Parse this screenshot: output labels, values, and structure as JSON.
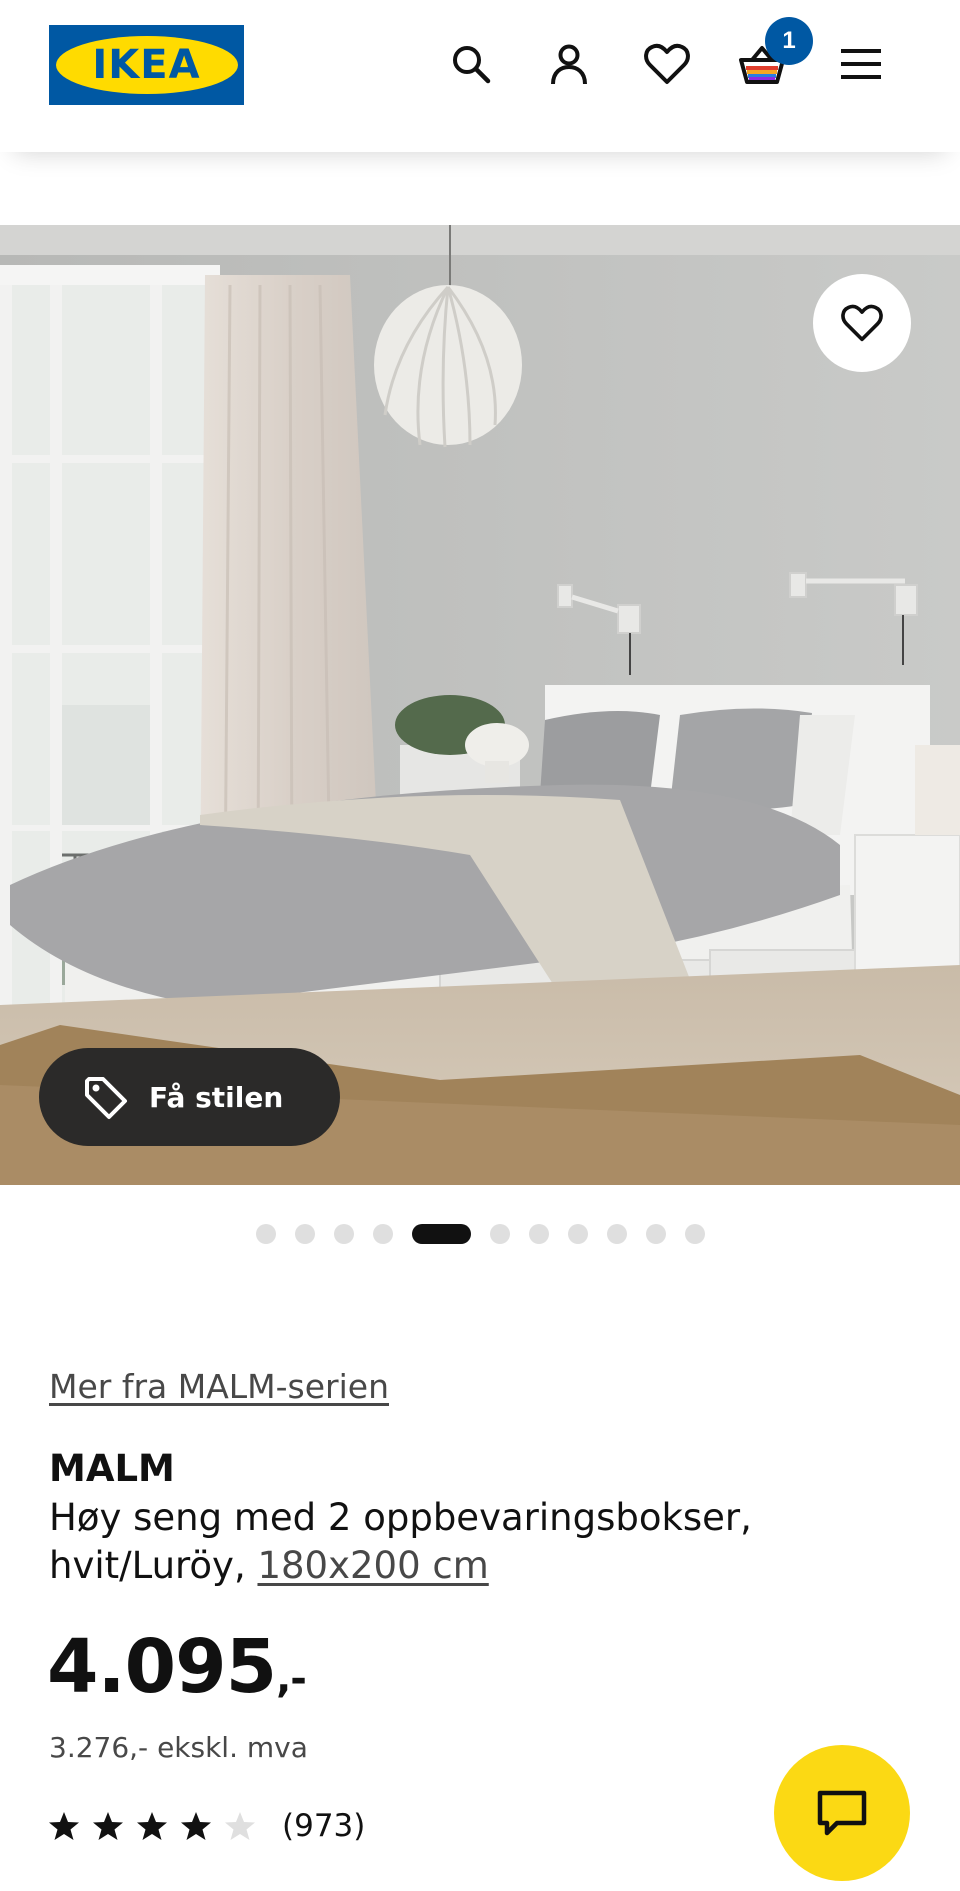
{
  "header": {
    "logo_text": "IKEA",
    "icons": [
      "search-icon",
      "account-icon",
      "heart-icon",
      "cart-icon",
      "menu-icon"
    ],
    "cart_count": "1"
  },
  "hero": {
    "style_button_label": "Få stilen",
    "image_count": 11,
    "active_image_index": 4
  },
  "product": {
    "series_link": "Mer fra MALM-serien",
    "name": "MALM",
    "description": "Høy seng med 2 oppbevaringsbokser, hvit/Luröy, ",
    "size_link": "180x200 cm",
    "price_main": "4.095",
    "price_suffix": ",-",
    "price_ex_vat": "3.276,- ekskl. mva",
    "rating": 4,
    "rating_max": 5,
    "review_count": "(973)"
  },
  "colors": {
    "ikea_blue": "#0058a3",
    "ikea_yellow": "#ffdb00",
    "chat_yellow": "#fbd914",
    "dark_button": "#2b2a29"
  }
}
